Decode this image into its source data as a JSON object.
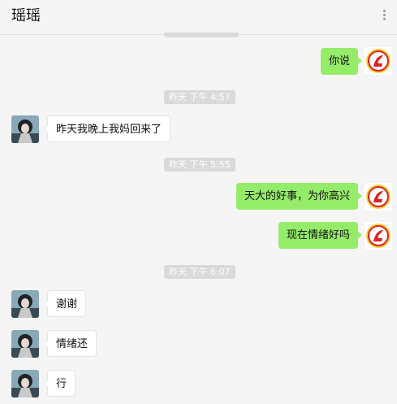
{
  "chat": {
    "title": "瑶瑶"
  },
  "timestamps": [
    "昨天 下午 4:57",
    "昨天 下午 5:55",
    "昨天 下午 6:07"
  ],
  "messages": [
    {
      "side": "out",
      "text": "你说"
    },
    {
      "side": "in",
      "text": "昨天我晚上我妈回来了"
    },
    {
      "side": "out",
      "text": "天大的好事，为你高兴"
    },
    {
      "side": "out",
      "text": "现在情绪好吗"
    },
    {
      "side": "in",
      "text": "谢谢"
    },
    {
      "side": "in",
      "text": "情绪还"
    },
    {
      "side": "in",
      "text": "行"
    }
  ],
  "colors": {
    "out_bubble": "#95ec69",
    "in_bubble": "#ffffff",
    "timestamp_bg": "#dadada",
    "background": "#f5f5f5"
  },
  "icons": {
    "menu": "more-dots-icon",
    "self_avatar": "red-logo-avatar",
    "contact_avatar": "photo-avatar"
  }
}
